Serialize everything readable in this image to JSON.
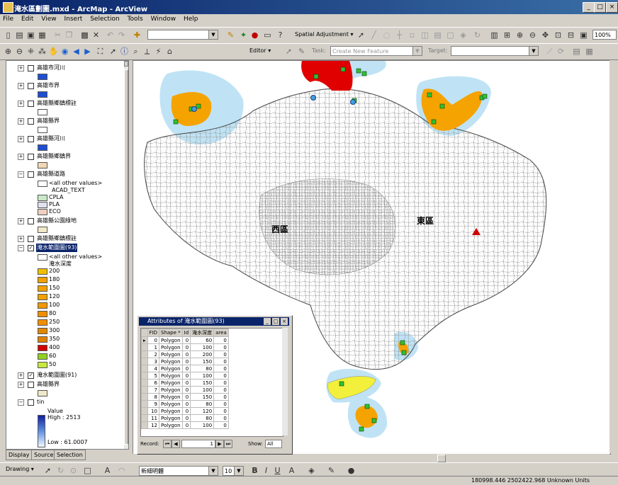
{
  "window": {
    "title": "淹水區劃圖.mxd - ArcMap - ArcView",
    "min": "_",
    "max": "□",
    "close": "×"
  },
  "menu": [
    "File",
    "Edit",
    "View",
    "Insert",
    "Selection",
    "Tools",
    "Window",
    "Help"
  ],
  "toolbar1": {
    "scale_value": "",
    "spatial_adjustment_label": "Spatial Adjustment ▾",
    "zoom_value": "100%"
  },
  "toolbar2": {
    "editor_label": "Editor ▾",
    "task_label": "Task:",
    "task_value": "Create New Feature",
    "target_label": "Target:",
    "target_value": ""
  },
  "toc": {
    "layers": [
      {
        "label": "高雄市河川",
        "checked": false,
        "swatch": "#1f4fd0"
      },
      {
        "label": "高雄市界",
        "checked": false,
        "swatch": "#1f4fd0"
      },
      {
        "label": "高雄縣鄉鎮標註",
        "checked": false,
        "swatch": "#ffffff"
      },
      {
        "label": "高雄縣界",
        "checked": false,
        "swatch": "#ffffff"
      },
      {
        "label": "高雄縣河川",
        "checked": false,
        "swatch": "#1f4fd0"
      },
      {
        "label": "高雄縣鄉鎮界",
        "checked": false,
        "swatch": "#f0d8b8"
      },
      {
        "label": "高雄縣道路",
        "checked": false,
        "swatch": null
      },
      {
        "label": "高雄縣公園綠地",
        "checked": false,
        "swatch": "#f0e8c8"
      },
      {
        "label": "高雄縣鄉鎮標註",
        "checked": false,
        "swatch": null
      },
      {
        "label": "淹水範圍圖(93)",
        "checked": true,
        "swatch": null,
        "selected": true
      },
      {
        "label": "淹水範圍圖(91)",
        "checked": true,
        "swatch": null
      },
      {
        "label": "高雄縣界",
        "checked": false,
        "swatch": "#f0e8c8"
      },
      {
        "label": "tin",
        "checked": false,
        "swatch": null
      }
    ],
    "road_legend": [
      {
        "label": "<all other values>",
        "swatch": "#ffffff"
      },
      {
        "label": "ACAD_TEXT",
        "swatch": null
      },
      {
        "label": "CPLA",
        "swatch": "#c8e8c8"
      },
      {
        "label": "PLA",
        "swatch": "#e0e0f0"
      },
      {
        "label": "ECO",
        "swatch": "#f0d0c0"
      }
    ],
    "flood_legend_header": [
      "<all other values>",
      "淹水深度"
    ],
    "flood_classes": [
      {
        "label": "200",
        "swatch": "#f0c000"
      },
      {
        "label": "180",
        "swatch": "#f0a000"
      },
      {
        "label": "150",
        "swatch": "#f0a000"
      },
      {
        "label": "120",
        "swatch": "#f0a000"
      },
      {
        "label": "100",
        "swatch": "#f09800"
      },
      {
        "label": "80",
        "swatch": "#f09000"
      },
      {
        "label": "250",
        "swatch": "#f09000"
      },
      {
        "label": "300",
        "swatch": "#e08800"
      },
      {
        "label": "350",
        "swatch": "#e08000"
      },
      {
        "label": "400",
        "swatch": "#d00000"
      },
      {
        "label": "60",
        "swatch": "#90d020"
      },
      {
        "label": "50",
        "swatch": "#c8e840"
      }
    ],
    "tin": {
      "title": "Value",
      "high": "High : 2513",
      "low": "Low : 61.0007"
    },
    "tabs": [
      "Display",
      "Source",
      "Selection"
    ]
  },
  "map": {
    "district_west": "西區",
    "district_east": "東區",
    "colors": {
      "water": "#bfe3f5",
      "flood": "#f5a300",
      "red": "#e00000",
      "yellow": "#f2f03a",
      "road": "#8a8a8a",
      "boundary": "#444444"
    }
  },
  "attr_table": {
    "title": "Attributes of 淹水範圍圖(93)",
    "columns": [
      "FID",
      "Shape *",
      "Id",
      "淹水深度",
      "area"
    ],
    "rows": [
      [
        "0",
        "Polygon",
        "0",
        "60",
        "0"
      ],
      [
        "1",
        "Polygon",
        "0",
        "100",
        "0"
      ],
      [
        "2",
        "Polygon",
        "0",
        "200",
        "0"
      ],
      [
        "3",
        "Polygon",
        "0",
        "150",
        "0"
      ],
      [
        "4",
        "Polygon",
        "0",
        "80",
        "0"
      ],
      [
        "5",
        "Polygon",
        "0",
        "100",
        "0"
      ],
      [
        "6",
        "Polygon",
        "0",
        "150",
        "0"
      ],
      [
        "7",
        "Polygon",
        "0",
        "100",
        "0"
      ],
      [
        "8",
        "Polygon",
        "0",
        "150",
        "0"
      ],
      [
        "9",
        "Polygon",
        "0",
        "80",
        "0"
      ],
      [
        "10",
        "Polygon",
        "0",
        "120",
        "0"
      ],
      [
        "11",
        "Polygon",
        "0",
        "80",
        "0"
      ],
      [
        "12",
        "Polygon",
        "0",
        "100",
        "0"
      ]
    ],
    "record_label": "Record:",
    "record_value": "1",
    "show_label": "Show:",
    "show_value": "All"
  },
  "drawbar": {
    "drawing_label": "Drawing ▾",
    "font_value": "新細明體",
    "size_value": "10",
    "bold": "B",
    "italic": "I",
    "underline": "U"
  },
  "status": {
    "coords": "180998.446  2502422.968 Unknown Units"
  }
}
